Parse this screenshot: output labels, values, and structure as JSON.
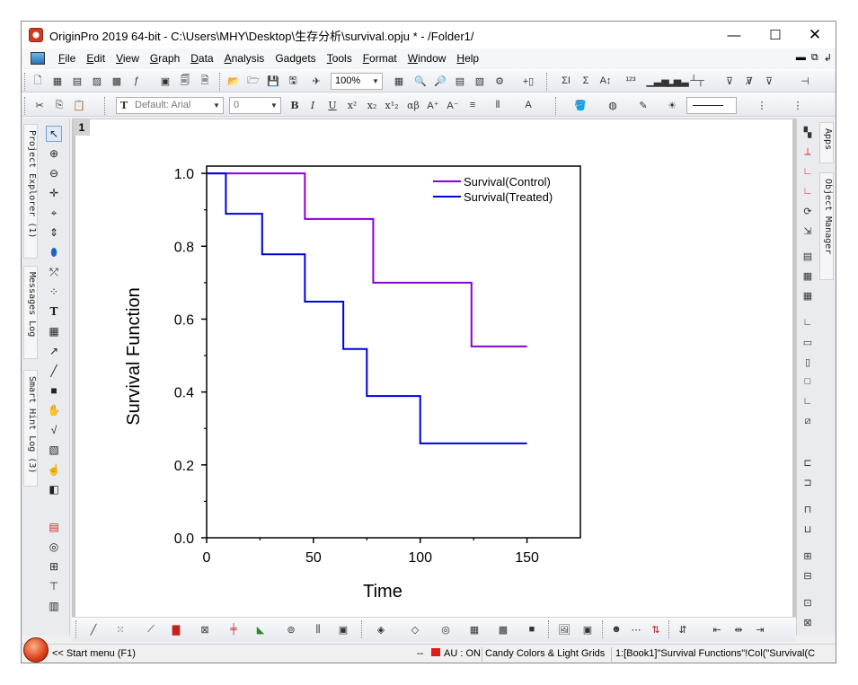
{
  "window": {
    "title": "OriginPro 2019 64-bit - C:\\Users\\MHY\\Desktop\\生存分析\\survival.opju * - /Folder1/",
    "controls": {
      "minimize": "—",
      "maximize": "☐",
      "close": "✕"
    }
  },
  "menu": {
    "items": [
      {
        "label": "File",
        "mnemonic": "F",
        "rest": "ile"
      },
      {
        "label": "Edit",
        "mnemonic": "E",
        "rest": "dit"
      },
      {
        "label": "View",
        "mnemonic": "V",
        "rest": "iew"
      },
      {
        "label": "Graph",
        "mnemonic": "G",
        "rest": "raph"
      },
      {
        "label": "Data",
        "mnemonic": "D",
        "rest": "ata"
      },
      {
        "label": "Analysis",
        "mnemonic": "A",
        "rest": "nalysis"
      },
      {
        "label": "Gadgets",
        "mnemonic": "",
        "rest": "Gadgets"
      },
      {
        "label": "Tools",
        "mnemonic": "T",
        "rest": "ools"
      },
      {
        "label": "Format",
        "mnemonic": "F",
        "rest": "ormat"
      },
      {
        "label": "Window",
        "mnemonic": "W",
        "rest": "indow"
      },
      {
        "label": "Help",
        "mnemonic": "H",
        "rest": "elp"
      }
    ]
  },
  "toolbar": {
    "zoom": "100%",
    "font_name": "Default: Arial",
    "font_size": "0"
  },
  "side_panels": {
    "left": [
      "Project Explorer (1)",
      "Messages Log",
      "Smart Hint Log (3)"
    ],
    "right": [
      "Apps",
      "Object Manager"
    ]
  },
  "graph": {
    "page_number": "1",
    "chart_data": {
      "type": "line",
      "step": true,
      "xlabel": "Time",
      "ylabel": "Survival Function",
      "xlim": [
        0,
        175
      ],
      "ylim": [
        0,
        1.02
      ],
      "xticks": [
        0,
        50,
        100,
        150
      ],
      "yticks": [
        0.0,
        0.2,
        0.4,
        0.6,
        0.8,
        1.0
      ],
      "xtick_labels": [
        "0",
        "50",
        "100",
        "150"
      ],
      "ytick_labels": [
        "0.0",
        "0.2",
        "0.4",
        "0.6",
        "0.8",
        "1.0"
      ],
      "legend_position": "top-right",
      "grid": false,
      "series": [
        {
          "name": "Survival(Control)",
          "color": "#8a00d4",
          "x": [
            0,
            46,
            46,
            78,
            78,
            124,
            124,
            150
          ],
          "y": [
            1.0,
            1.0,
            0.875,
            0.875,
            0.7,
            0.7,
            0.525,
            0.525
          ]
        },
        {
          "name": "Survival(Treated)",
          "color": "#0000dd",
          "x": [
            0,
            9,
            9,
            26,
            26,
            46,
            46,
            64,
            64,
            75,
            75,
            100,
            100,
            150
          ],
          "y": [
            1.0,
            1.0,
            0.889,
            0.889,
            0.778,
            0.778,
            0.648,
            0.648,
            0.518,
            0.518,
            0.389,
            0.389,
            0.259,
            0.259
          ]
        }
      ]
    }
  },
  "status": {
    "start_menu": "<< Start menu (F1)",
    "dashes": "--",
    "au": "AU : ON",
    "theme": "Candy Colors & Light Grids",
    "active_column": "1:[Book1]\"Survival Functions\"!Col(\"Survival(C"
  }
}
